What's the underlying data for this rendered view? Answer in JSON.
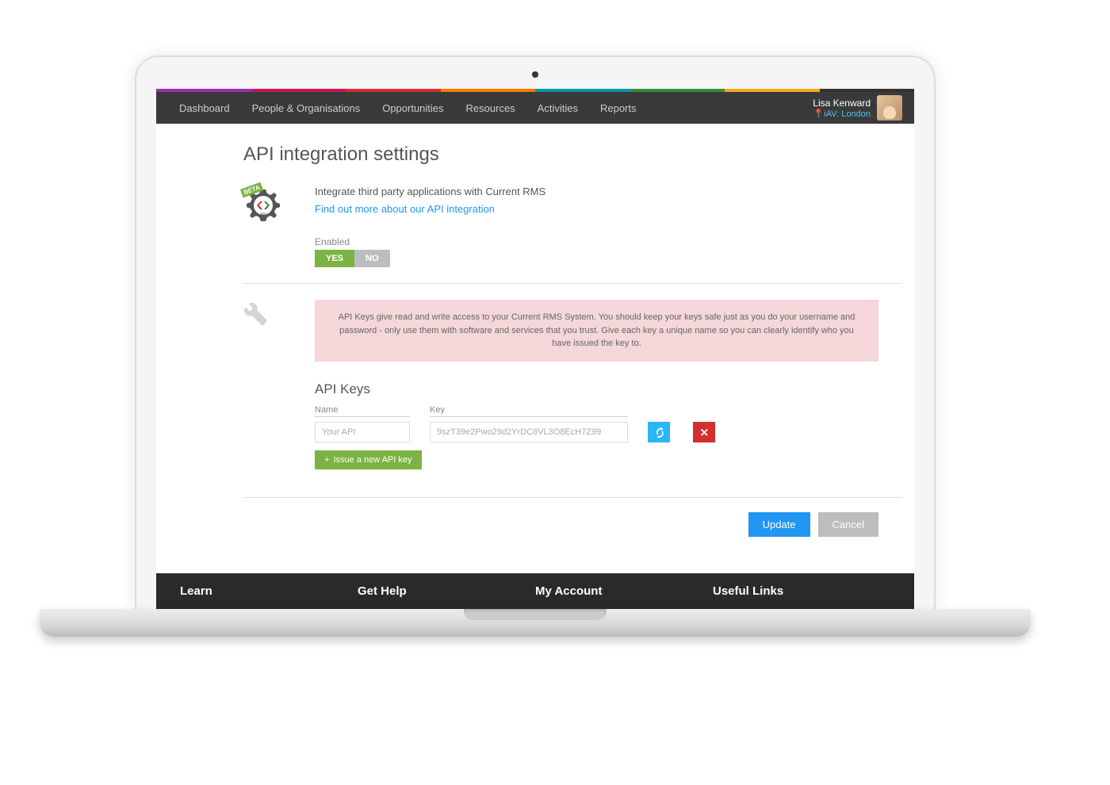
{
  "nav": {
    "items": [
      "Dashboard",
      "People & Organisations",
      "Opportunities",
      "Resources",
      "Activities",
      "Reports"
    ]
  },
  "user": {
    "name": "Lisa Kenward",
    "location": "iAV: London"
  },
  "page": {
    "title": "API integration settings",
    "intro_desc": "Integrate third party applications with Current RMS",
    "intro_link": "Find out more about our API integration",
    "beta_label": "BETA",
    "api_label": "API",
    "enabled_label": "Enabled",
    "toggle_yes": "YES",
    "toggle_no": "NO"
  },
  "warning": "API Keys give read and write access to your Current RMS System. You should keep your keys safe just as you do your username and password - only use them with software and services that you trust. Give each key a unique name so you can clearly identify who you have issued the key to.",
  "keys": {
    "heading": "API Keys",
    "name_label": "Name",
    "key_label": "Key",
    "name_value": "Your API",
    "key_value": "9szT39e2Pwo29d2YrDC6VL3O8EcH7Z99",
    "issue_label": "Issue a new API key"
  },
  "actions": {
    "update": "Update",
    "cancel": "Cancel"
  },
  "footer": {
    "items": [
      "Learn",
      "Get Help",
      "My Account",
      "Useful Links"
    ]
  }
}
